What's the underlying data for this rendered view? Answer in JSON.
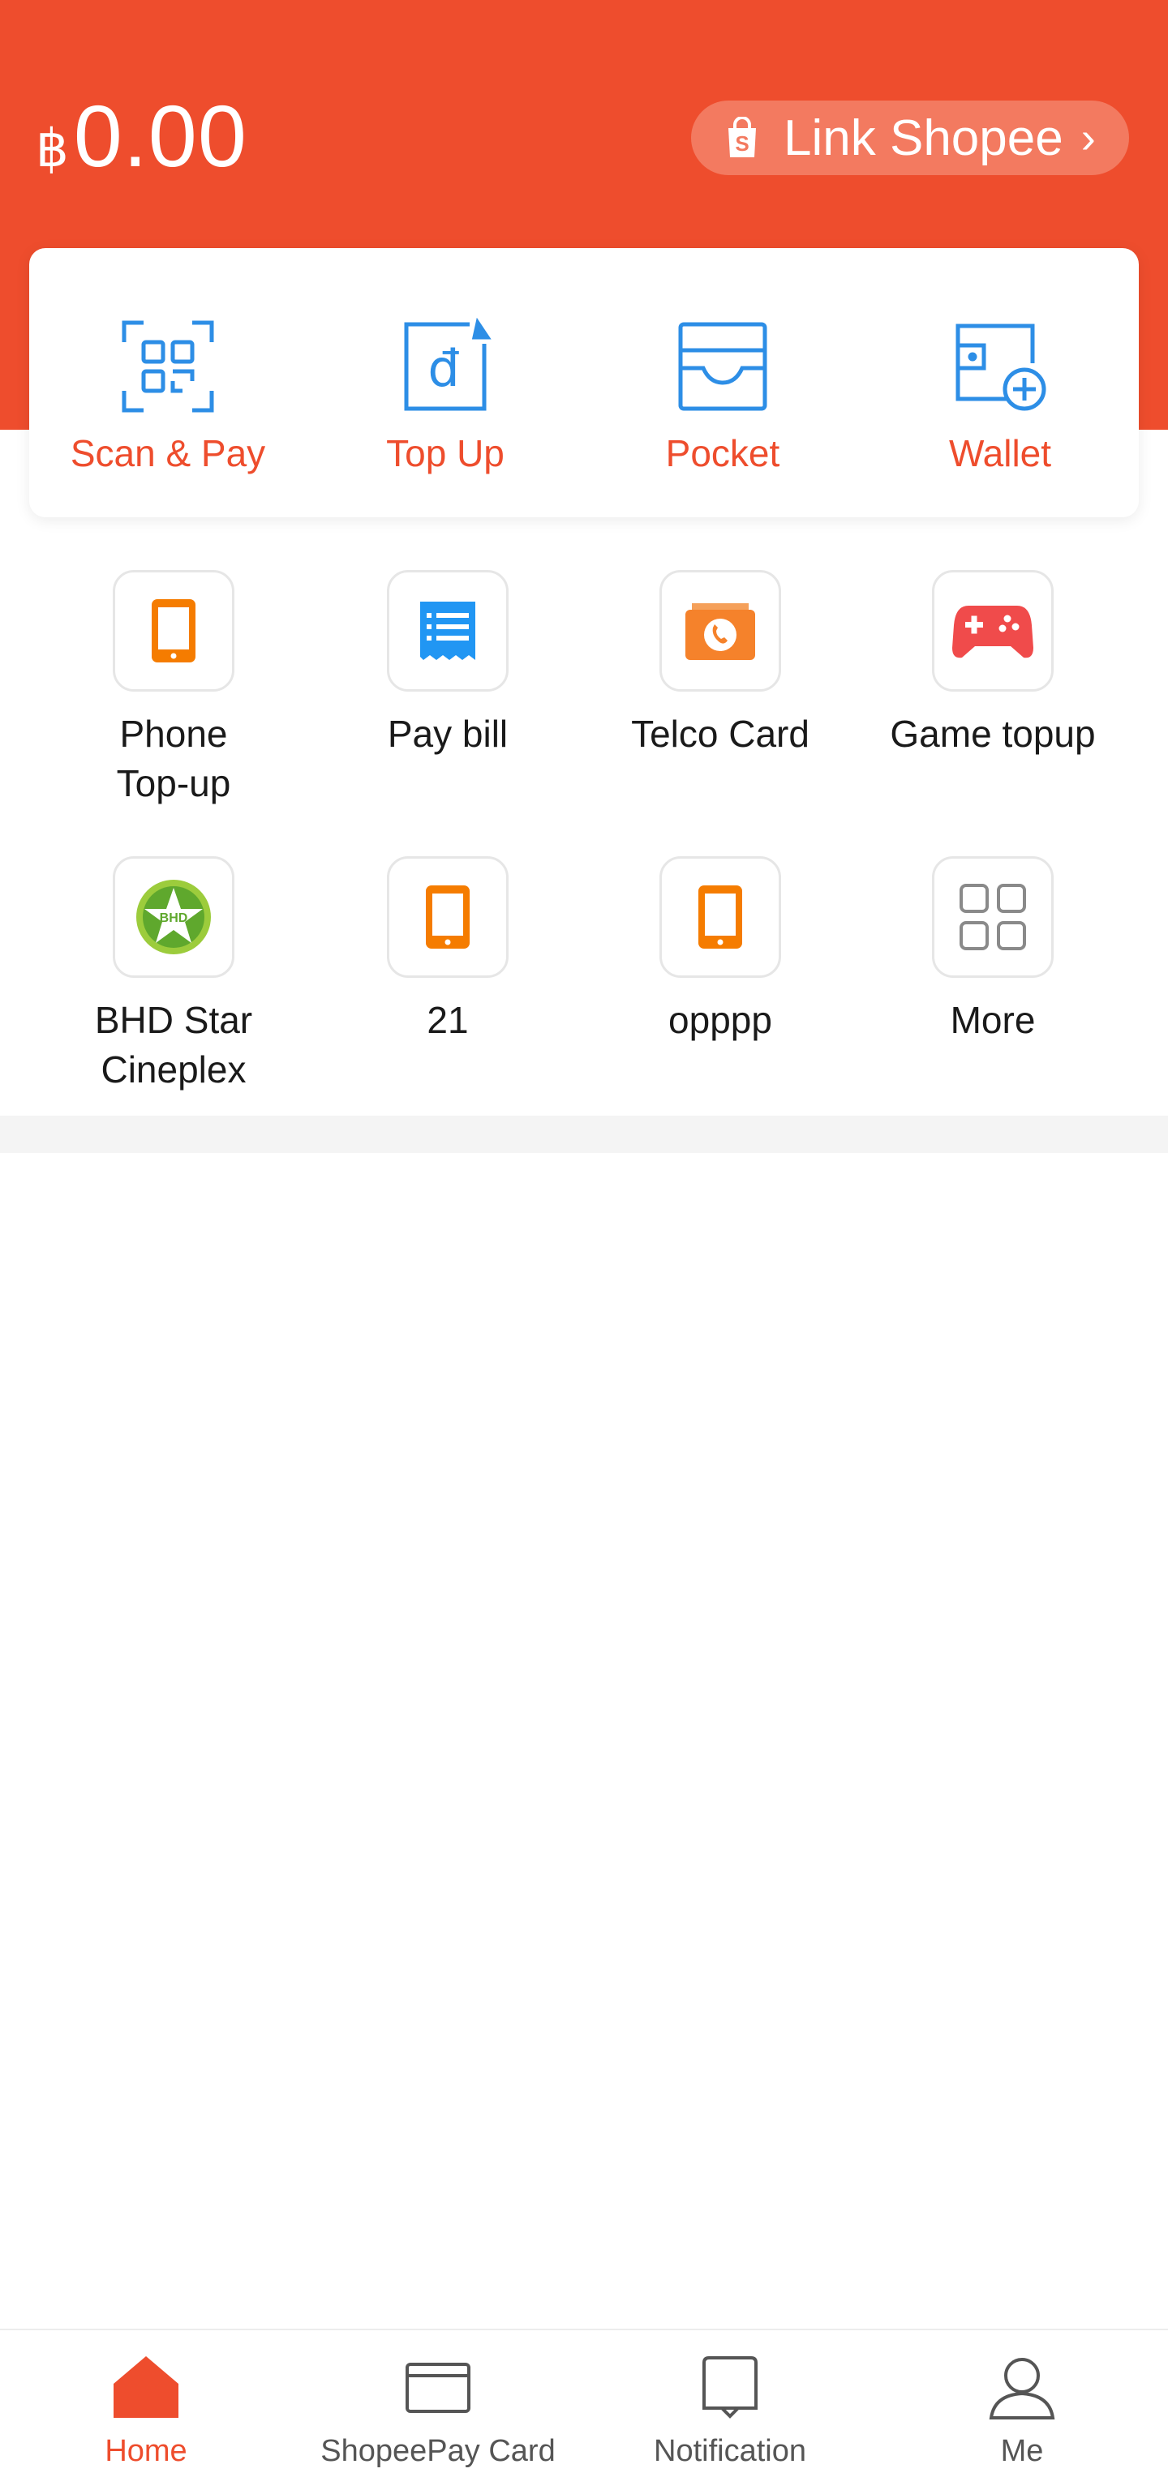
{
  "header": {
    "currency_symbol": "฿",
    "balance": "0.00",
    "link_button": {
      "label": "Link Shopee",
      "icon": "shopee-bag-icon",
      "chevron": "›"
    },
    "brand_color": "#ee4d2d"
  },
  "actions": [
    {
      "label": "Scan & Pay",
      "icon": "qr-scan-icon"
    },
    {
      "label": "Top Up",
      "icon": "top-up-dong-icon"
    },
    {
      "label": "Pocket",
      "icon": "pocket-icon"
    },
    {
      "label": "Wallet",
      "icon": "wallet-add-icon"
    }
  ],
  "services": [
    {
      "label": "Phone\nTop-up",
      "icon": "phone-icon",
      "color": "#f57c00"
    },
    {
      "label": "Pay bill",
      "icon": "bill-icon",
      "color": "#2196f3"
    },
    {
      "label": "Telco Card",
      "icon": "telco-card-icon",
      "color": "#f5822b"
    },
    {
      "label": "Game topup",
      "icon": "gamepad-icon",
      "color": "#f04b4b"
    },
    {
      "label": "BHD Star\nCineplex",
      "icon": "bhd-star-logo-icon",
      "color": "#8bc34a"
    },
    {
      "label": "21",
      "icon": "phone-icon",
      "color": "#f57c00"
    },
    {
      "label": "opppp",
      "icon": "phone-icon",
      "color": "#f57c00"
    },
    {
      "label": "More",
      "icon": "grid-more-icon",
      "color": "#8a8a8a"
    }
  ],
  "bhd_logo_text": "BHD",
  "bottom_nav": [
    {
      "label": "Home",
      "icon": "home-icon",
      "active": true
    },
    {
      "label": "ShopeePay Card",
      "icon": "card-icon",
      "active": false
    },
    {
      "label": "Notification",
      "icon": "bell-icon",
      "active": false
    },
    {
      "label": "Me",
      "icon": "person-icon",
      "active": false
    }
  ]
}
